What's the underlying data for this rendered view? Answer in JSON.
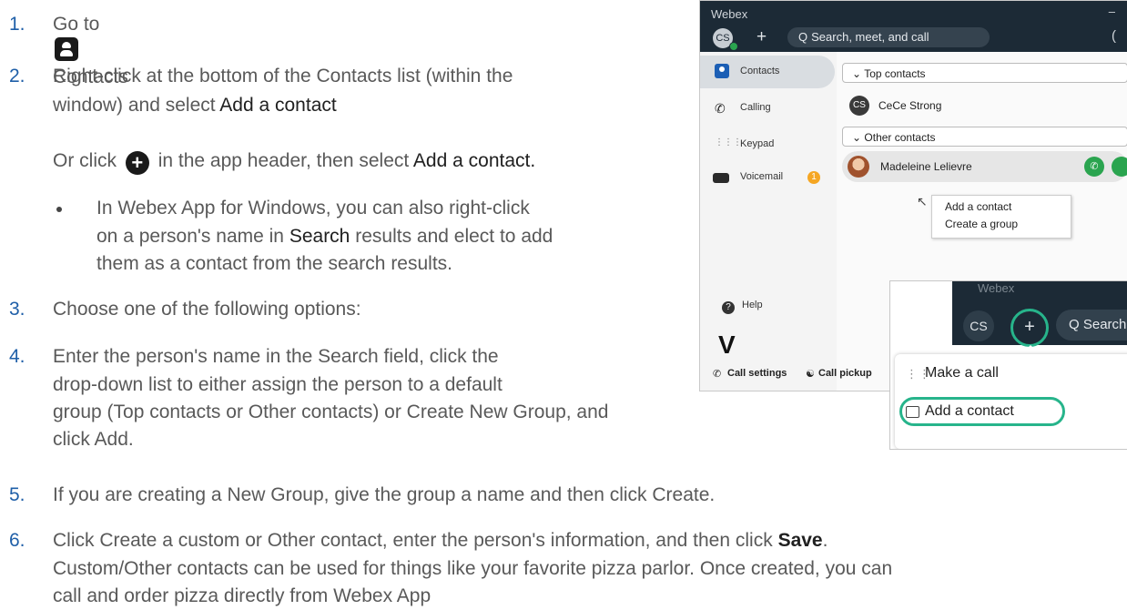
{
  "steps": [
    {
      "num": "1.",
      "pre": "Go to",
      "post": "Contacts"
    },
    {
      "num": "2.",
      "line1": "Right-click at the bottom of the Contacts list (within the",
      "line2_pre": "window) and select",
      "line2_em": "Add a contact"
    },
    {
      "or_pre": "Or click",
      "or_mid": "in the app header, then select",
      "or_em": "Add a contact."
    },
    {
      "bullet_line1": "In Webex App for Windows, you can also right-click",
      "bullet_line2_pre": "on a person's name in",
      "bullet_line2_em": "Search",
      "bullet_line2_post": "results and elect to add",
      "bullet_line3": "them as a contact from the search results."
    },
    {
      "num": "3.",
      "text": "Choose one of the following options:"
    },
    {
      "num": "4.",
      "line1": "Enter the person's name in the Search field, click the",
      "line2": "drop-down list to either assign the person to a default",
      "line3": "group (Top contacts or Other contacts) or Create New Group, and",
      "line4": "click Add."
    },
    {
      "num": "5.",
      "text": "If you are creating a New Group, give the group a name and then click Create."
    },
    {
      "num": "6.",
      "line1_pre": "Click Create a custom or Other contact, enter the person's information, and then click",
      "line1_bold": "Save",
      "line1_post": ".",
      "line2": "Custom/Other contacts can be used for things like your favorite pizza parlor. Once created, you can",
      "line3": "call and order pizza directly from Webex App"
    }
  ],
  "webex": {
    "title": "Webex",
    "minimize": "–",
    "avatar": "CS",
    "plus": "+",
    "search_placeholder": "Search, meet, and call",
    "right_glyph": "(",
    "nav": [
      "Contacts",
      "Calling",
      "Keypad",
      "Voicemail"
    ],
    "voicemail_badge": "1",
    "groups": [
      "Top contacts",
      "Other contacts"
    ],
    "contacts": [
      {
        "initials": "CS",
        "name": "CeCe Strong"
      },
      {
        "name": "Madeleine Lelievre"
      }
    ],
    "context_menu": [
      "Add a contact",
      "Create a group"
    ],
    "help": "Help",
    "logo": "V",
    "footer": [
      "Call settings",
      "Call pickup"
    ]
  },
  "inset": {
    "title": "Webex",
    "avatar": "CS",
    "plus": "+",
    "search": "Search",
    "menu": [
      "Make a call",
      "Add a contact"
    ]
  },
  "icons": {
    "contacts_icon": "contacts-icon",
    "plus_icon": "plus-circle-icon",
    "accent": "#27b48b",
    "number_color": "#1f5fa8"
  }
}
